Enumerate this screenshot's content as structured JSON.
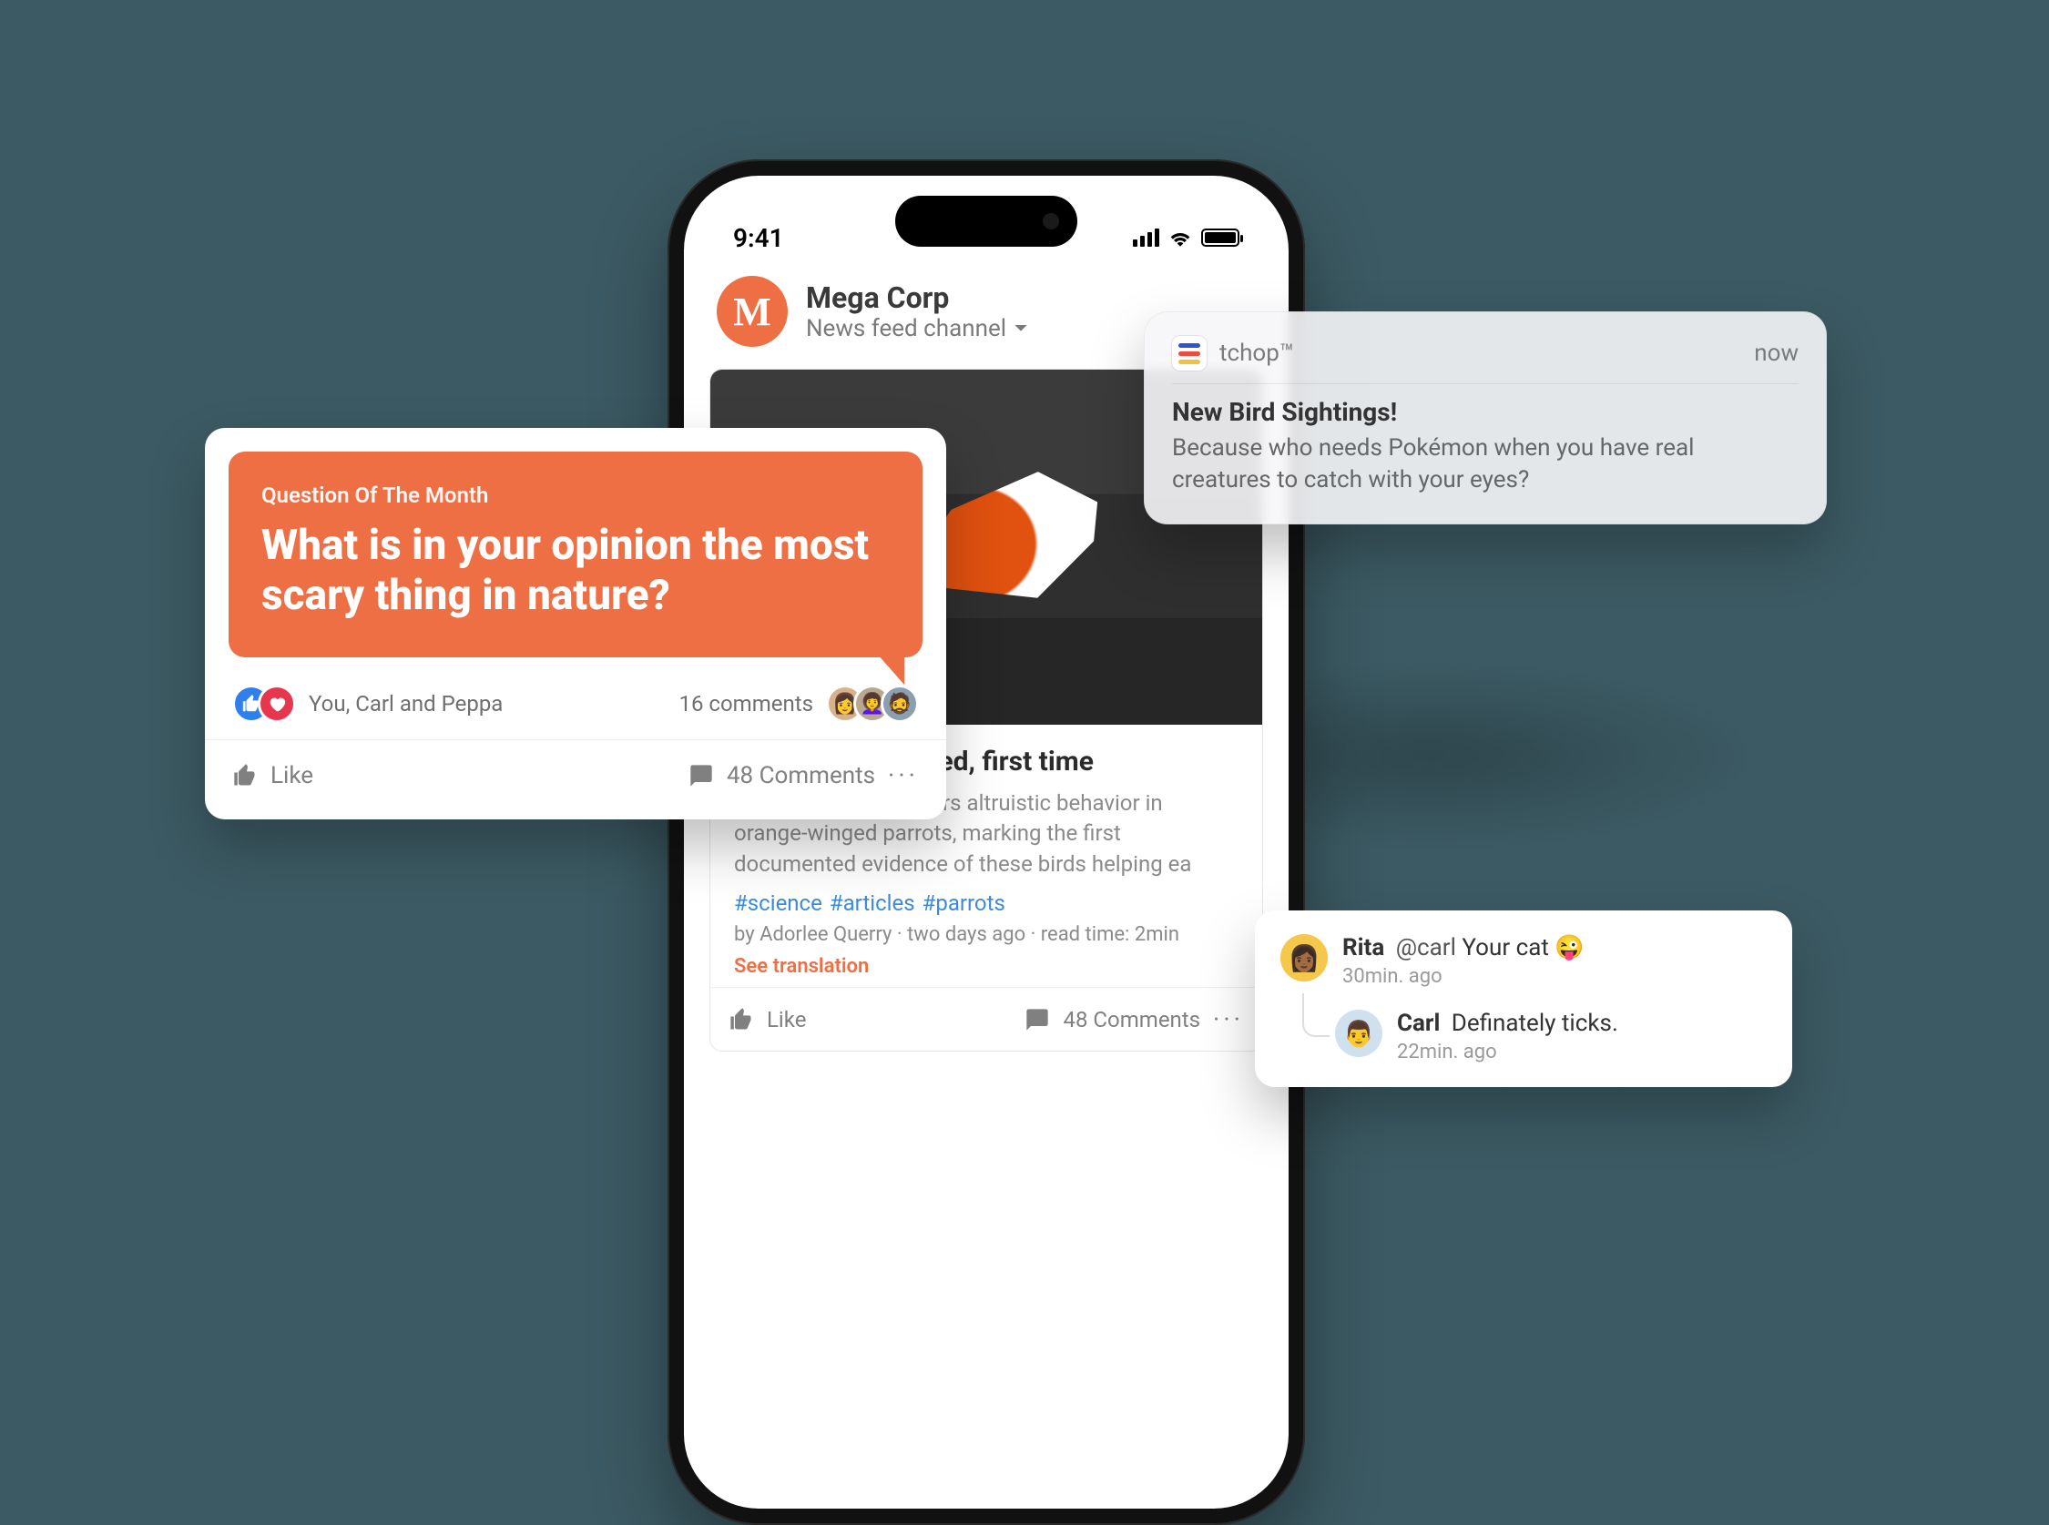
{
  "colors": {
    "accent": "#ee6f44",
    "link": "#3d8bd6"
  },
  "phone": {
    "status": {
      "time": "9:41"
    },
    "channel": {
      "badge_letter": "M",
      "title": "Mega Corp",
      "subtitle": "News feed channel"
    },
    "article": {
      "title": "help others in need, first time",
      "excerpt": "New research uncovers altruistic behavior in orange-winged parrots, marking the first documented evidence of these birds helping ea",
      "tags": [
        "#science",
        "#articles",
        "#parrots"
      ],
      "byline": "by Adorlee Querry · two days ago · read time: 2min",
      "see_translation": "See translation",
      "actions": {
        "like": "Like",
        "comments_label": "48 Comments"
      }
    }
  },
  "question_card": {
    "kicker": "Question Of The Month",
    "question": "What is in your opinion the most scary thing in nature?",
    "reactions_summary": "You, Carl and Peppa",
    "comments_short": "16 comments",
    "actions": {
      "like": "Like",
      "comments_label": "48 Comments"
    }
  },
  "push": {
    "app_name": "tchop™",
    "when": "now",
    "title": "New Bird Sightings!",
    "body": "Because who needs Pokémon when you have real creatures to catch with your eyes?"
  },
  "comments": {
    "items": [
      {
        "user": "Rita",
        "mention": "@carl",
        "text": "Your cat",
        "emoji": "😜",
        "time": "30min. ago"
      },
      {
        "user": "Carl",
        "text": "Definately ticks.",
        "time": "22min. ago"
      }
    ]
  }
}
